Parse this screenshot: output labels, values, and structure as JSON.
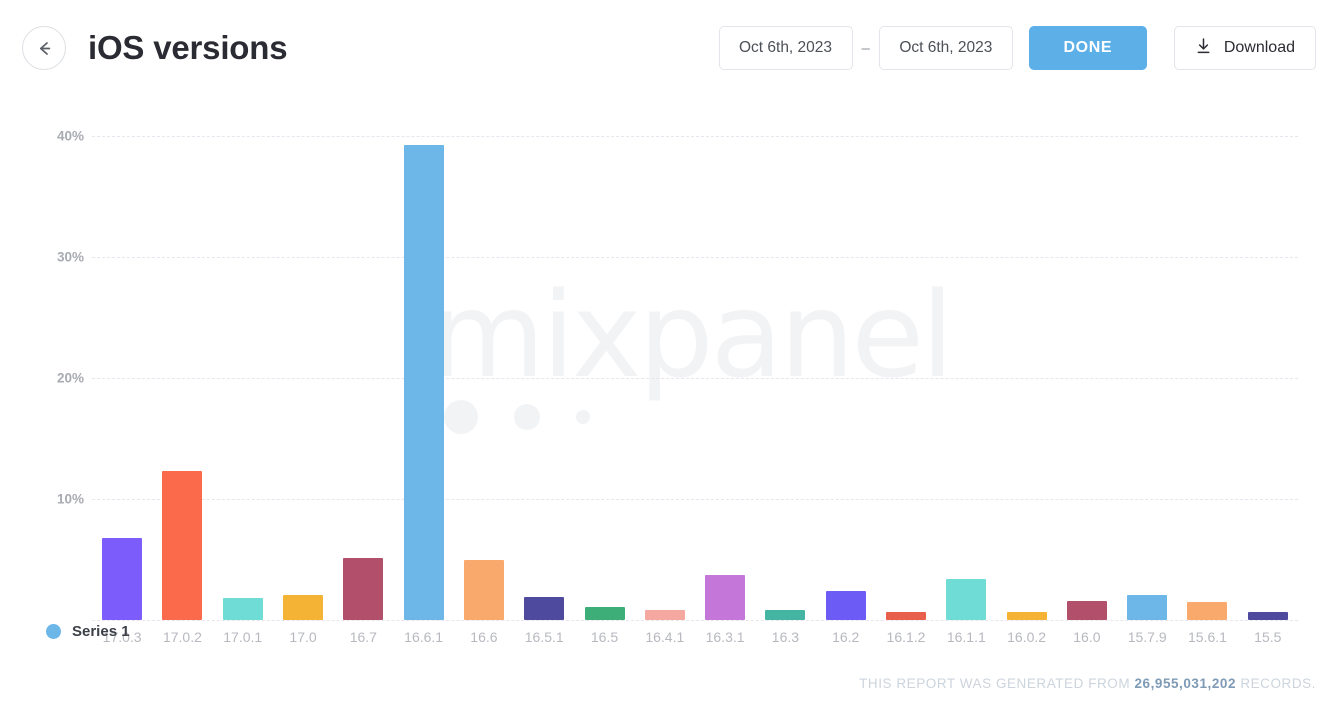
{
  "header": {
    "back_icon": "arrow-left-icon",
    "title": "iOS versions",
    "date_from": "Oct 6th, 2023",
    "date_separator": "–",
    "date_to": "Oct 6th, 2023",
    "done_label": "DONE",
    "download_label": "Download",
    "download_icon": "download-icon",
    "done_color": "#5dafe8"
  },
  "legend": {
    "label": "Series 1",
    "color": "#6cb6e8"
  },
  "watermark": {
    "text": "mixpanel",
    "color": "#f2f3f5"
  },
  "footer": {
    "prefix": "THIS REPORT WAS GENERATED FROM",
    "count": "26,955,031,202",
    "suffix": "RECORDS.",
    "count_color": "#7e9ab4"
  },
  "chart_data": {
    "type": "bar",
    "title": "iOS versions",
    "xlabel": "",
    "ylabel": "",
    "ylim": [
      0,
      41
    ],
    "grid": true,
    "legend_position": "bottom-left",
    "ytick_labels": [
      "10%",
      "20%",
      "30%",
      "40%"
    ],
    "ytick_values": [
      10,
      20,
      30,
      40
    ],
    "categories": [
      "17.0.3",
      "17.0.2",
      "17.0.1",
      "17.0",
      "16.7",
      "16.6.1",
      "16.6",
      "16.5.1",
      "16.5",
      "16.4.1",
      "16.3.1",
      "16.3",
      "16.2",
      "16.1.2",
      "16.1.1",
      "16.0.2",
      "16.0",
      "15.7.9",
      "15.6.1",
      "15.5"
    ],
    "values": [
      6.8,
      12.3,
      1.8,
      2.1,
      5.1,
      39.3,
      5.0,
      1.9,
      1.1,
      0.8,
      3.7,
      0.8,
      2.4,
      0.7,
      3.4,
      0.7,
      1.6,
      2.1,
      1.5,
      0.7
    ],
    "colors": [
      "#7c5cfa",
      "#fb6b4b",
      "#6fddd5",
      "#f5b335",
      "#b2506b",
      "#6cb6e8",
      "#f9a96b",
      "#4e4b9e",
      "#3dae77",
      "#f5a8a0",
      "#c476d9",
      "#45b5a3",
      "#6c5bf5",
      "#e8604c",
      "#6fddd5",
      "#f5b335",
      "#b2506b",
      "#6cb6e8",
      "#f9a96b",
      "#4e4b9e"
    ],
    "series": [
      {
        "name": "Series 1",
        "values": [
          6.8,
          12.3,
          1.8,
          2.1,
          5.1,
          39.3,
          5.0,
          1.9,
          1.1,
          0.8,
          3.7,
          0.8,
          2.4,
          0.7,
          3.4,
          0.7,
          1.6,
          2.1,
          1.5,
          0.7
        ]
      }
    ]
  }
}
